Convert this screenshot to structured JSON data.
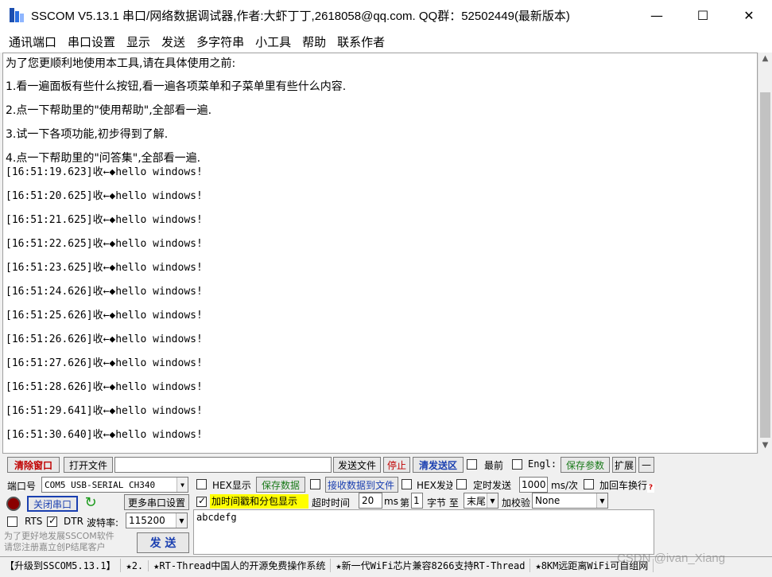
{
  "window": {
    "title": "SSCOM V5.13.1 串口/网络数据调试器,作者:大虾丁丁,2618058@qq.com. QQ群：52502449(最新版本)",
    "minimize": "—",
    "maximize": "☐",
    "close": "✕"
  },
  "menu": [
    "通讯端口",
    "串口设置",
    "显示",
    "发送",
    "多字符串",
    "小工具",
    "帮助",
    "联系作者"
  ],
  "receive": {
    "intro": [
      "为了您更顺利地使用本工具,请在具体使用之前:",
      "1.看一遍面板有些什么按钮,看一遍各项菜单和子菜单里有些什么内容.",
      "2.点一下帮助里的\"使用帮助\",全部看一遍.",
      "3.试一下各项功能,初步得到了解.",
      "4.点一下帮助里的\"问答集\",全部看一遍."
    ],
    "log": [
      "[16:51:19.623]收←◆hello windows!",
      "[16:51:20.625]收←◆hello windows!",
      "[16:51:21.625]收←◆hello windows!",
      "[16:51:22.625]收←◆hello windows!",
      "[16:51:23.625]收←◆hello windows!",
      "[16:51:24.626]收←◆hello windows!",
      "[16:51:25.626]收←◆hello windows!",
      "[16:51:26.626]收←◆hello windows!",
      "[16:51:27.626]收←◆hello windows!",
      "[16:51:28.626]收←◆hello windows!",
      "[16:51:29.641]收←◆hello windows!",
      "[16:51:30.640]收←◆hello windows!"
    ]
  },
  "toolbar": {
    "clear_window": "清除窗口",
    "open_file": "打开文件",
    "file_path": "",
    "send_file": "发送文件",
    "stop": "停止",
    "clear_send": "清发送区",
    "latest": "最前",
    "english": "Engl:",
    "save_params": "保存参数",
    "expand": "扩展",
    "collapse": "—"
  },
  "port": {
    "port_label": "端口号",
    "port_value": "COM5 USB-SERIAL CH340",
    "close_port": "关闭串口",
    "more_settings": "更多串口设置",
    "rts": "RTS",
    "dtr": "DTR",
    "rts_checked": false,
    "dtr_checked": true,
    "baud_label": "波特率:",
    "baud_value": "115200",
    "promo": "为了更好地发展SSCOM软件\n请您注册嘉立创P结尾客户"
  },
  "options": {
    "hex_display": "HEX显示",
    "save_data": "保存数据",
    "recv_to_file": "接收数据到文件",
    "hex_send": "HEX发送",
    "timed_send": "定时发送",
    "interval": "1000",
    "interval_unit": "ms/次",
    "add_crlf": "加回车换行",
    "timestamp": "加时间戳和分包显示",
    "timestamp_checked": true,
    "timeout_label": "超时时间",
    "timeout_value": "20",
    "ms": "ms",
    "nth_label": "第",
    "nth_value": "1",
    "byte_label": "字节 至",
    "end_value": "末尾",
    "checksum_label": "加校验",
    "checksum_value": "None"
  },
  "send": {
    "text": "abcdefg",
    "send_button": "发 送"
  },
  "status": [
    "【升级到SSCOM5.13.1】",
    "★2.",
    "★RT-Thread中国人的开源免费操作系统",
    "★新一代WiFi芯片兼容8266支持RT-Thread",
    "★8KM远距离WiFi可自组网"
  ],
  "watermark": "CSDN @ivan_Xiang"
}
